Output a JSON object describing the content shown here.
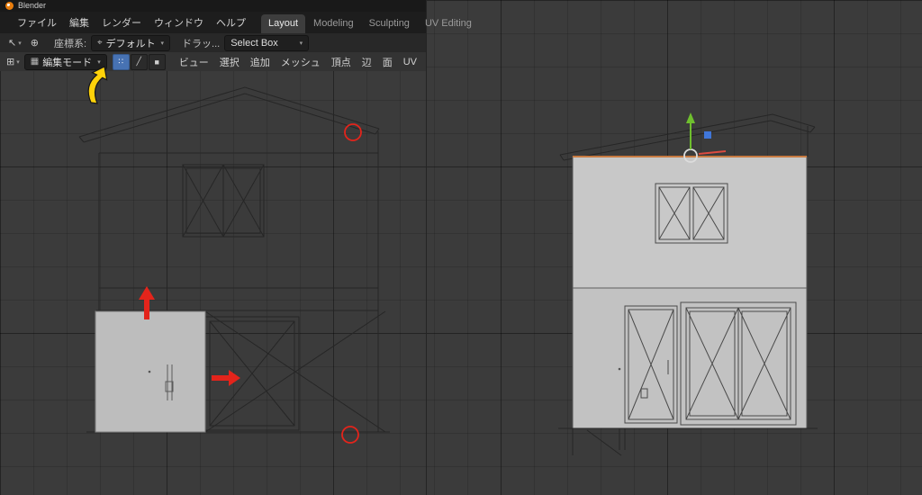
{
  "window": {
    "title": "Blender"
  },
  "menubar": {
    "menus": [
      "ファイル",
      "編集",
      "レンダー",
      "ウィンドウ",
      "ヘルプ"
    ],
    "workspaces": [
      {
        "label": "Layout",
        "active": true
      },
      {
        "label": "Modeling",
        "active": false
      },
      {
        "label": "Sculpting",
        "active": false
      },
      {
        "label": "UV Editing",
        "active": false
      }
    ]
  },
  "tool_settings": {
    "orientation_label": "座標系:",
    "orientation_value": "デフォルト",
    "drag_label": "ドラッ...",
    "tool_value": "Select Box"
  },
  "viewport_header": {
    "mode_value": "編集モード",
    "select_modes": [
      {
        "name": "vertex-select",
        "active": true
      },
      {
        "name": "edge-select",
        "active": false
      },
      {
        "name": "face-select",
        "active": false
      }
    ],
    "menus": [
      "ビュー",
      "選択",
      "追加",
      "メッシュ",
      "頂点",
      "辺",
      "面",
      "UV"
    ]
  },
  "colors": {
    "accent_blue": "#4772b3",
    "annotation_red": "#e3241b",
    "annotation_yellow": "#ffd20a",
    "selected_edge_orange": "#c77b42",
    "viewport_bg": "#3b3b3b",
    "selected_face_gray": "#bdbdbd"
  }
}
